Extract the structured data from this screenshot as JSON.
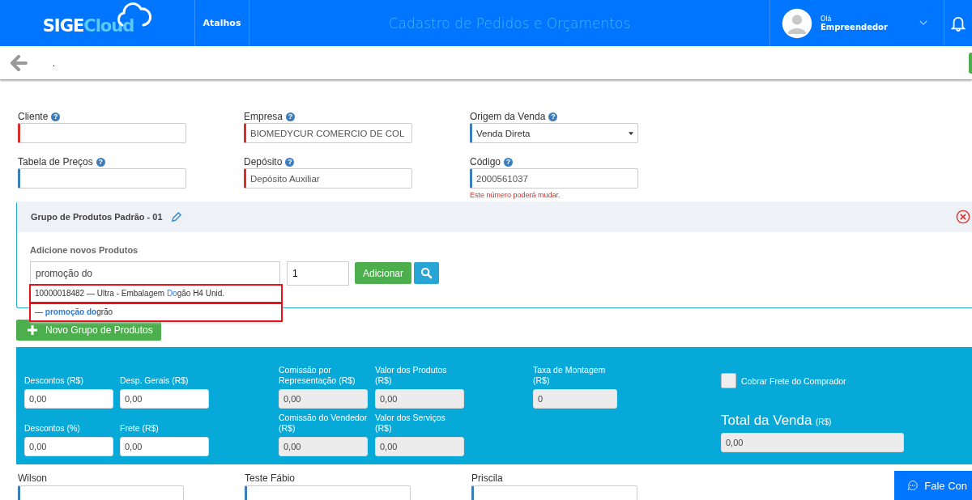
{
  "header": {
    "logo_main": "SIGE",
    "logo_accent": "Cloud",
    "shortcuts": "Atalhos",
    "title": "Cadastro de Pedidos e Orçamentos",
    "greeting": "Olá",
    "user": "Empreendedor"
  },
  "toolbar": {
    "text": "."
  },
  "form_rows": [
    [
      {
        "label": "Cliente",
        "help": "?",
        "required": true,
        "kind": "text"
      },
      {
        "label": "Empresa",
        "help": "?",
        "value": "BIOMEDYCUR COMERCIO DE COL",
        "required": true,
        "kind": "text"
      },
      {
        "label": "Origem da Venda",
        "help": "?",
        "value": "Venda Direta",
        "required": false,
        "kind": "select"
      }
    ],
    [
      {
        "label": "Tabela de Preços",
        "help": "?",
        "required": false,
        "kind": "text"
      },
      {
        "label": "Depósito",
        "help": "?",
        "value": "Depósito Auxiliar",
        "required": true,
        "kind": "text"
      },
      {
        "label": "Código",
        "help": "?",
        "value": "2000561037",
        "required": false,
        "kind": "text",
        "note": "Este número poderá mudar."
      }
    ]
  ],
  "product_group": {
    "title": "Grupo de Produtos Padrão - 01",
    "add_label": "Adicione novos Produtos",
    "search_value": "promoção do",
    "quantity": "1",
    "add_button": "Adicionar",
    "suggestions": [
      {
        "highlighted": true,
        "parts": [
          {
            "text": "10000018482 — Ultra - Embalagem ",
            "match": false,
            "bold": false
          },
          {
            "text": "Do",
            "match": true,
            "bold": false
          },
          {
            "text": "gão H4 Unid.",
            "match": false,
            "bold": false
          }
        ]
      },
      {
        "highlighted": true,
        "parts": [
          {
            "text": "— ",
            "match": false,
            "bold": false
          },
          {
            "text": "promoção do",
            "match": true,
            "bold": true
          },
          {
            "text": "grão",
            "match": false,
            "bold": false
          }
        ]
      }
    ]
  },
  "new_group_button": "Novo Grupo de Produtos",
  "totals": {
    "columns": [
      [
        {
          "label": "Descontos (R$)",
          "value": "0,00",
          "readonly": false
        },
        {
          "label": "Descontos (%)",
          "value": "0,00",
          "readonly": false
        }
      ],
      [
        {
          "label": "Desp. Gerais (R$)",
          "value": "0,00",
          "readonly": false
        },
        {
          "label": "Frete (R$)",
          "value": "0,00",
          "readonly": false
        }
      ],
      [
        {
          "label": "Comissão por Representação (R$)",
          "value": "0,00",
          "readonly": true
        },
        {
          "label": "Comissão do Vendedor (R$)",
          "value": "0,00",
          "readonly": true
        }
      ],
      [
        {
          "label": "Valor dos Produtos (R$)",
          "value": "0,00",
          "readonly": true
        },
        {
          "label": "Valor dos Serviços (R$)",
          "value": "0,00",
          "readonly": true
        }
      ],
      [
        {
          "label": "Taxa de Montagem (R$)",
          "value": "0",
          "readonly": true
        }
      ]
    ],
    "freight_checkbox": {
      "label": "Cobrar Frete do Comprador",
      "checked": false
    },
    "total": {
      "label": "Total da Venda",
      "unit": "(R$)",
      "value": "0,00"
    }
  },
  "sellers": [
    {
      "label": "Wilson"
    },
    {
      "label": "Teste Fábio"
    },
    {
      "label": "Priscila"
    }
  ],
  "chat_button": "Fale Con"
}
